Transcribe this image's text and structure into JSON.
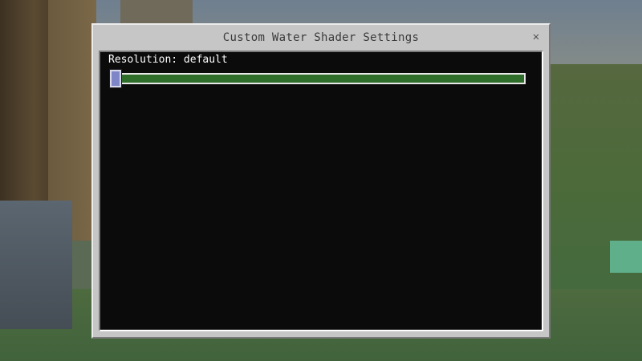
{
  "dialog": {
    "title": "Custom Water Shader Settings",
    "close_icon": "close-icon",
    "close_glyph": "✕"
  },
  "settings": {
    "resolution": {
      "label": "Resolution: default",
      "value_fraction": 0.0
    }
  },
  "colors": {
    "dialog_bg": "#c6c6c6",
    "content_bg": "#0b0b0b",
    "slider_fill": "#2f6d2a",
    "slider_thumb": "#7f86c8"
  }
}
